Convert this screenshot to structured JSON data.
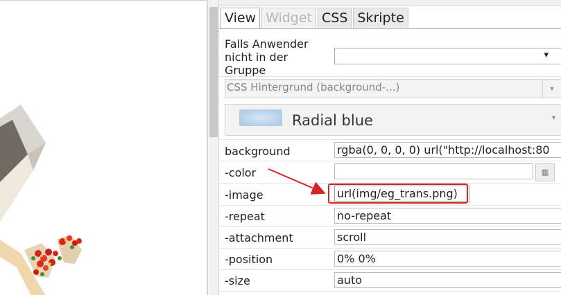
{
  "tabs": [
    {
      "label": "View",
      "state": "active"
    },
    {
      "label": "Widget",
      "state": "disabled"
    },
    {
      "label": "CSS",
      "state": "normal"
    },
    {
      "label": "Skripte",
      "state": "normal"
    }
  ],
  "group_field": {
    "label": "Falls Anwender nicht in der Gruppe",
    "label_lines": [
      "Falls Anwender",
      "nicht in der",
      "Gruppe"
    ],
    "value": "",
    "arrow": "▾"
  },
  "css_bg_select": {
    "text": "CSS Hintergrund (background-...)",
    "arrow": "▾"
  },
  "preset": {
    "name": "Radial blue",
    "arrow": "▾"
  },
  "properties": [
    {
      "label": "background",
      "value": "rgba(0, 0, 0, 0) url(\"http://localhost:80"
    },
    {
      "label": "-color",
      "value": ""
    },
    {
      "label": "-image",
      "value": "url(img/eg_trans.png)"
    },
    {
      "label": "-repeat",
      "value": "no-repeat"
    },
    {
      "label": "-attachment",
      "value": "scroll"
    },
    {
      "label": "-position",
      "value": "0% 0%"
    },
    {
      "label": "-size",
      "value": "auto"
    }
  ],
  "color_picker_icon": "color-picker-icon",
  "colors": {
    "highlight": "#d42424",
    "accent_swatch": "#a9c7e6"
  }
}
